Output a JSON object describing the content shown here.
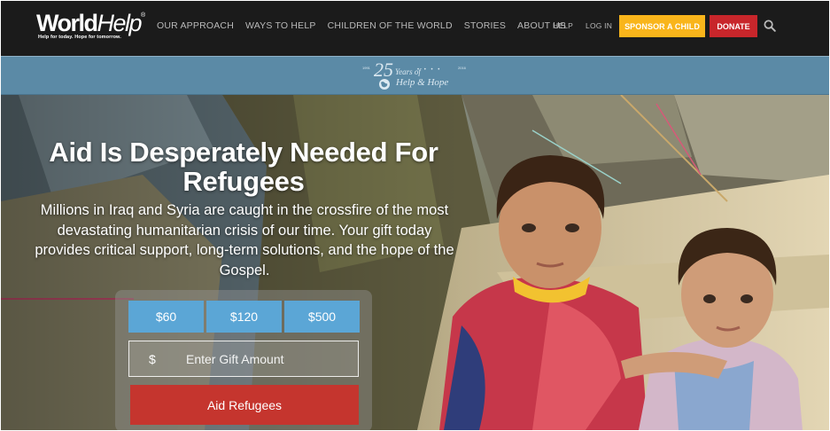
{
  "brand": {
    "logo_word": "World",
    "logo_word2": "Help",
    "registered": "®",
    "tagline": "Help for today. Hope for tomorrow."
  },
  "nav": {
    "main_links": [
      "OUR APPROACH",
      "WAYS TO HELP",
      "CHILDREN OF THE WORLD",
      "STORIES",
      "ABOUT US"
    ],
    "util_links": [
      "HELP",
      "LOG IN"
    ],
    "sponsor_label": "SPONSOR A CHILD",
    "donate_label": "DONATE",
    "search_icon": "search-icon"
  },
  "banner": {
    "year_start": "1991",
    "year_end": "2016",
    "number": "25",
    "years_text": "Years of",
    "tagline": "Help & Hope"
  },
  "hero": {
    "headline": "Aid Is Desperately Needed For Refugees",
    "subtext": "Millions in Iraq and Syria are caught in the crossfire of the most devastating humanitarian crisis of our time. Your gift today provides critical support, long-term solutions, and the hope of the Gospel."
  },
  "donation": {
    "amounts": [
      "$60",
      "$120",
      "$500"
    ],
    "currency_symbol": "$",
    "input_placeholder": "Enter Gift Amount",
    "submit_label": "Aid Refugees"
  },
  "colors": {
    "nav_bg": "#1b1b1b",
    "sponsor": "#f9b51b",
    "donate": "#c8262b",
    "banner": "#5b8aa6",
    "amount_button": "#5ba6d6",
    "submit_button": "#c5352e"
  }
}
